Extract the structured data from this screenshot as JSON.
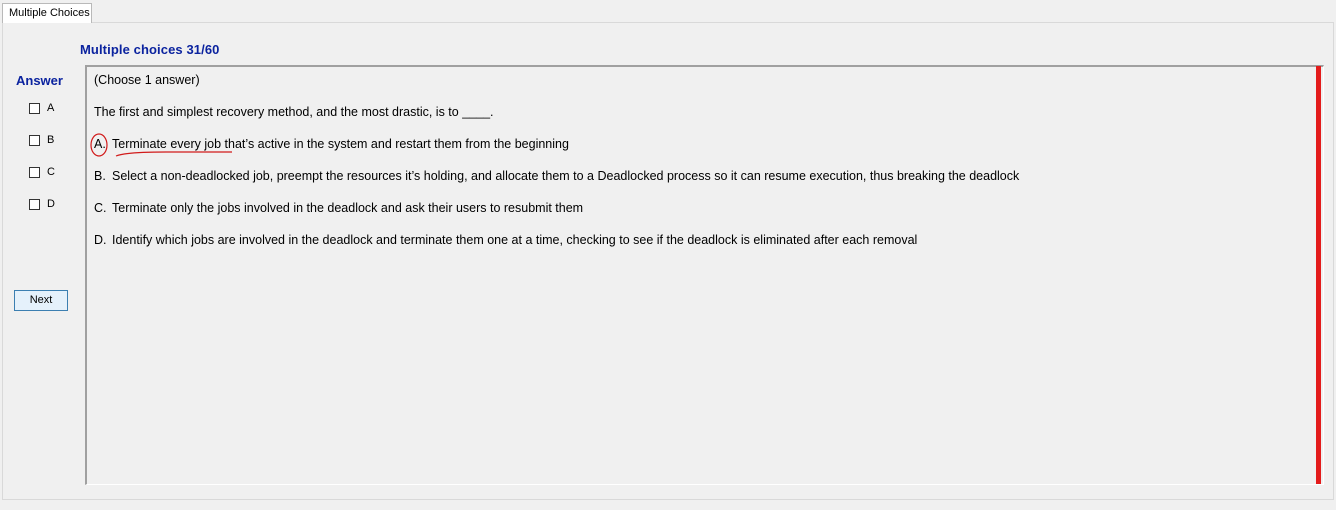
{
  "tab": {
    "label": "Multiple Choices"
  },
  "header": {
    "title": "Multiple choices 31/60"
  },
  "answer_panel": {
    "label": "Answer",
    "choices": [
      "A",
      "B",
      "C",
      "D"
    ],
    "next_label": "Next"
  },
  "question": {
    "instruction": "(Choose 1 answer)",
    "stem": "The first and simplest recovery method, and the most drastic, is to ____.",
    "options": [
      {
        "letter": "A.",
        "text": "Terminate every job that’s active in the system and restart them from the beginning"
      },
      {
        "letter": "B.",
        "text": "Select a non-deadlocked job, preempt the resources it’s holding, and allocate them to a Deadlocked process so it can resume execution, thus breaking the deadlock"
      },
      {
        "letter": "C.",
        "text": "Terminate only the jobs involved in the deadlock and ask their users to resubmit them"
      },
      {
        "letter": "D.",
        "text": "Identify which jobs are involved in the deadlock and terminate them one at a time, checking to see if the deadlock is eliminated after each removal"
      }
    ]
  },
  "colors": {
    "title": "#0b239f",
    "scroll_bar": "#e31b1b",
    "annotation": "#d11a1a"
  }
}
